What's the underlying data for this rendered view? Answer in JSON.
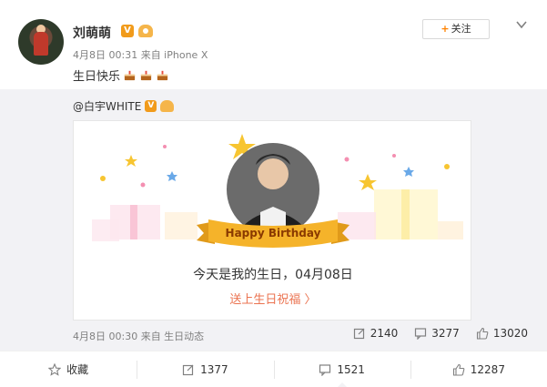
{
  "author": {
    "name": "刘萌萌",
    "meta": "4月8日 00:31 来自 iPhone X"
  },
  "follow_button": {
    "plus": "+",
    "label": "关注"
  },
  "post": {
    "text": "生日快乐"
  },
  "repost": {
    "author": "@白宇WHITE",
    "banner_text": "Happy Birthday",
    "message": "今天是我的生日，04月08日",
    "link": "送上生日祝福 〉",
    "meta": "4月8日 00:30 来自 生日动态",
    "actions": {
      "share": "2140",
      "comment": "3277",
      "like": "13020"
    }
  },
  "footer": {
    "favorite": "收藏",
    "share": "1377",
    "comment": "1521",
    "like": "12287"
  },
  "colors": {
    "accent": "#ff8200",
    "link": "#eb7350",
    "vip": "#f19b1b",
    "banner": "#f5b32a"
  },
  "icons": [
    "more-chevron-icon",
    "verified-badge-icon",
    "level-badge-icon",
    "cake-icon",
    "share-icon",
    "comment-icon",
    "like-icon",
    "star-icon"
  ]
}
